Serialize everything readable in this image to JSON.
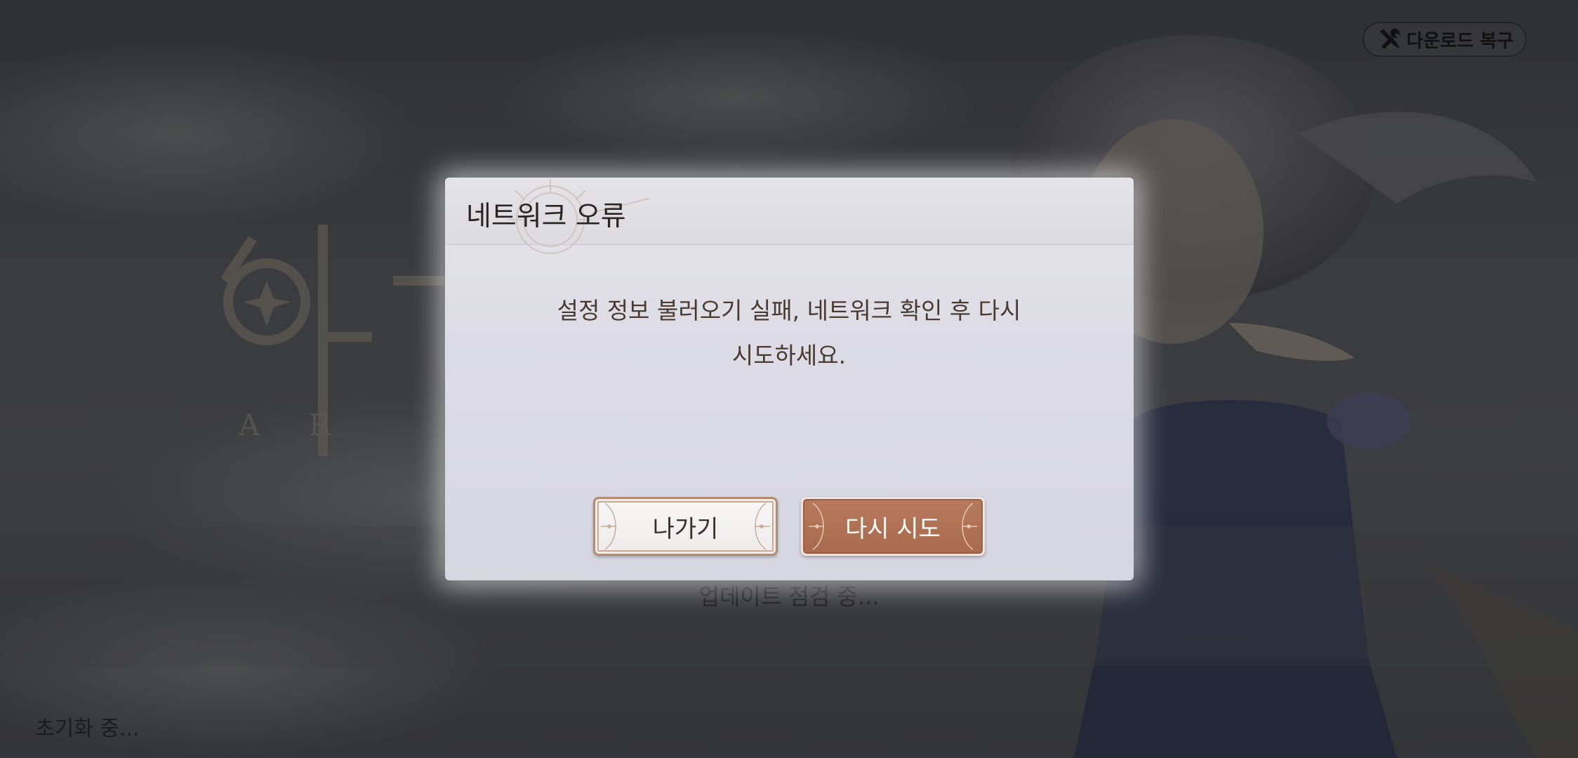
{
  "top_bar": {
    "repair_button_label": "다운로드 복구",
    "repair_icon": "wrench-screwdriver-icon"
  },
  "dialog": {
    "title": "네트워크 오류",
    "message": "설정 정보 불러오기 실패, 네트워크 확인 후 다시\n시도하세요.",
    "exit_label": "나가기",
    "retry_label": "다시 시도"
  },
  "status": {
    "update_text": "업데이트 점검 중...",
    "init_text": "초기화 중..."
  },
  "colors": {
    "accent": "#ad6f51",
    "dialog_bg": "#dddce6",
    "overlay": "#3a3b3f"
  }
}
